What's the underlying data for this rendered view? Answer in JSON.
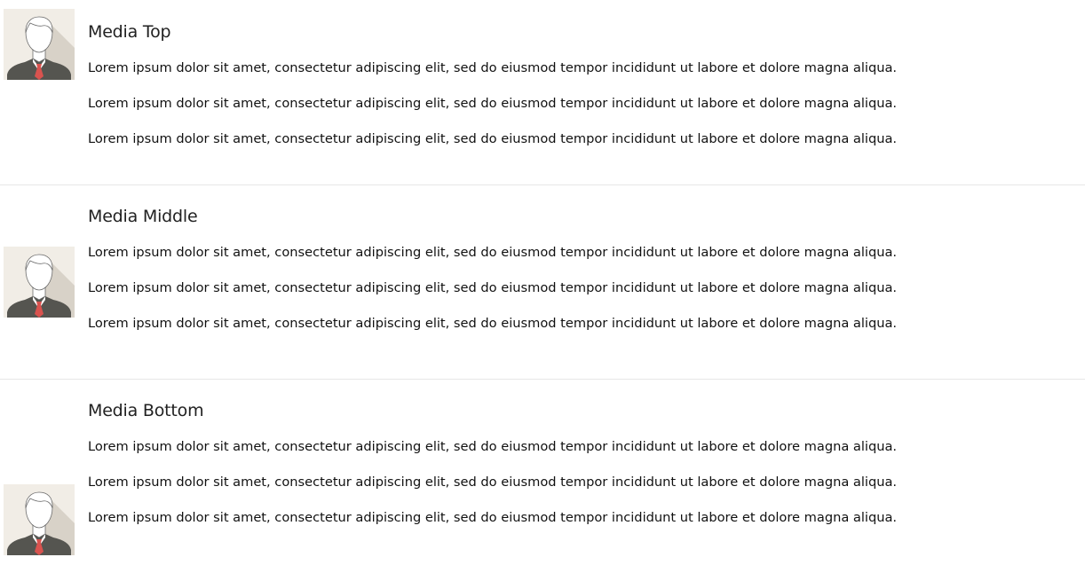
{
  "media_items": [
    {
      "heading": "Media Top",
      "avatar_icon": "user-avatar-icon",
      "paragraphs": [
        "Lorem ipsum dolor sit amet, consectetur adipiscing elit, sed do eiusmod tempor incididunt ut labore et dolore magna aliqua.",
        "Lorem ipsum dolor sit amet, consectetur adipiscing elit, sed do eiusmod tempor incididunt ut labore et dolore magna aliqua.",
        "Lorem ipsum dolor sit amet, consectetur adipiscing elit, sed do eiusmod tempor incididunt ut labore et dolore magna aliqua."
      ]
    },
    {
      "heading": "Media Middle",
      "avatar_icon": "user-avatar-icon",
      "paragraphs": [
        "Lorem ipsum dolor sit amet, consectetur adipiscing elit, sed do eiusmod tempor incididunt ut labore et dolore magna aliqua.",
        "Lorem ipsum dolor sit amet, consectetur adipiscing elit, sed do eiusmod tempor incididunt ut labore et dolore magna aliqua.",
        "Lorem ipsum dolor sit amet, consectetur adipiscing elit, sed do eiusmod tempor incididunt ut labore et dolore magna aliqua."
      ]
    },
    {
      "heading": "Media Bottom",
      "avatar_icon": "user-avatar-icon",
      "paragraphs": [
        "Lorem ipsum dolor sit amet, consectetur adipiscing elit, sed do eiusmod tempor incididunt ut labore et dolore magna aliqua.",
        "Lorem ipsum dolor sit amet, consectetur adipiscing elit, sed do eiusmod tempor incididunt ut labore et dolore magna aliqua.",
        "Lorem ipsum dolor sit amet, consectetur adipiscing elit, sed do eiusmod tempor incididunt ut labore et dolore magna aliqua."
      ]
    }
  ],
  "colors": {
    "avatar_background": "#f1ede6",
    "avatar_shadow": "#d8d2c8",
    "avatar_shirt": "#555550",
    "avatar_tie": "#d9534f",
    "divider": "#e7e7e7"
  }
}
